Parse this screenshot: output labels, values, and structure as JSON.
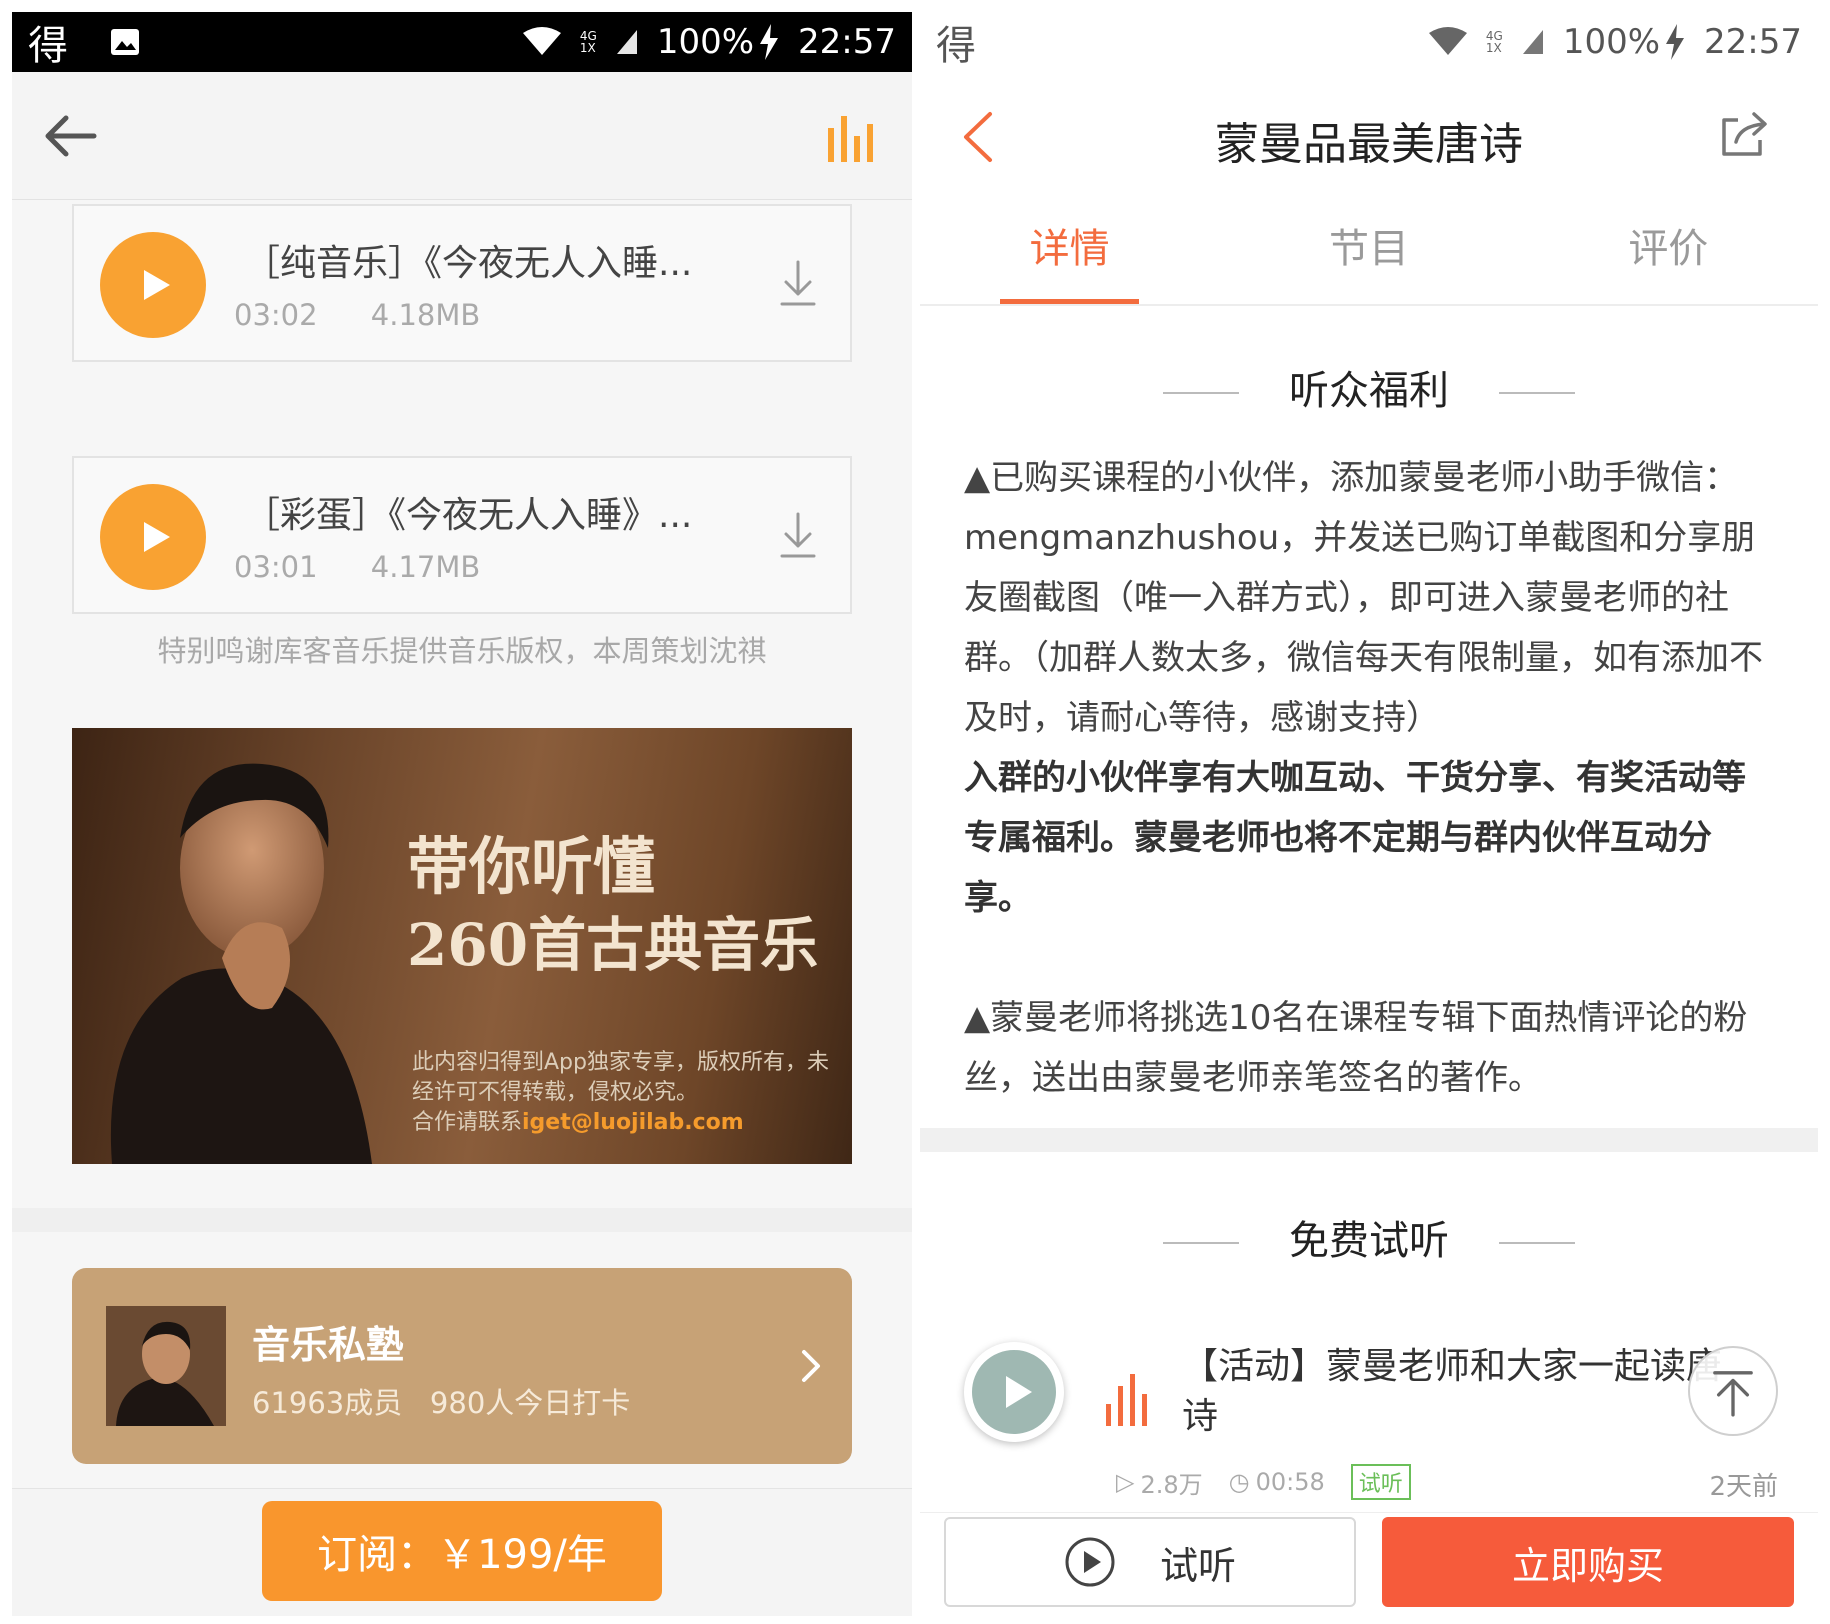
{
  "left": {
    "status": {
      "app": "得",
      "battery": "100%",
      "time": "22:57",
      "network_top": "4G",
      "network_bottom": "1X"
    },
    "tracks": [
      {
        "title": "［纯音乐］《今夜无人入睡...",
        "duration": "03:02",
        "size": "4.18MB"
      },
      {
        "title": "［彩蛋］《今夜无人入睡》...",
        "duration": "03:01",
        "size": "4.17MB"
      }
    ],
    "credits": "特别鸣谢库客音乐提供音乐版权，本周策划沈祺",
    "banner": {
      "headline_1": "带你听懂",
      "headline_2": "260首古典音乐",
      "notice": "此内容归得到App独家专享，版权所有，未经许可不得转载，侵权必究。",
      "contact_prefix": "合作请联系",
      "contact_email": "iget@luojilab.com"
    },
    "community": {
      "name": "音乐私塾",
      "members": "61963成员",
      "checkins": "980人今日打卡"
    },
    "subscribe_label": "订阅：￥199/年",
    "colors": {
      "accent": "#f9a232",
      "community_bg": "#c7a276",
      "subscribe": "#f9962d"
    }
  },
  "right": {
    "status": {
      "app": "得",
      "battery": "100%",
      "time": "22:57",
      "network_top": "4G",
      "network_bottom": "1X"
    },
    "title": "蒙曼品最美唐诗",
    "tabs": [
      {
        "label": "详情",
        "active": true
      },
      {
        "label": "节目",
        "active": false
      },
      {
        "label": "评价",
        "active": false
      }
    ],
    "benefits_heading": "听众福利",
    "benefits": {
      "p1": "▲已购买课程的小伙伴，添加蒙曼老师小助手微信：mengmanzhushou，并发送已购订单截图和分享朋友圈截图（唯一入群方式），即可进入蒙曼老师的社群。（加群人数太多，微信每天有限制量，如有添加不及时，请耐心等待，感谢支持）",
      "p1_bold": "入群的小伙伴享有大咖互动、干货分享、有奖活动等专属福利。蒙曼老师也将不定期与群内伙伴互动分享。",
      "p2": "▲蒙曼老师将挑选10名在课程专辑下面热情评论的粉丝，送出由蒙曼老师亲笔签名的著作。"
    },
    "trial_heading": "免费试听",
    "trial_item": {
      "title": "【活动】蒙曼老师和大家一起读唐诗",
      "plays": "2.8万",
      "duration": "00:58",
      "badge": "试听",
      "date": "2天前"
    },
    "listen_label": "试听",
    "buy_label": "立即购买",
    "colors": {
      "accent": "#f36c3e",
      "buy": "#f65b3b",
      "badge": "#6bbf59"
    }
  }
}
